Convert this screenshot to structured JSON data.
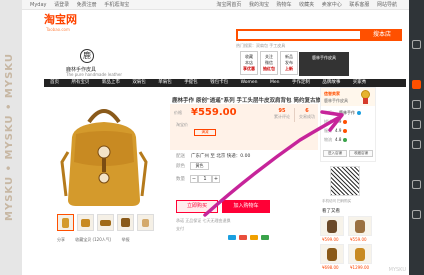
{
  "watermark": {
    "vertical": "MYSKU • MYSKU • MYSKU",
    "corner": "MYSKU"
  },
  "topbar": {
    "left": [
      "Myday",
      "请登录",
      "免费注册",
      "手机逛淘宝"
    ],
    "right": [
      "淘宝网首页",
      "我的淘宝",
      "购物车",
      "收藏夹",
      "卖家中心",
      "联系客服",
      "网站导航"
    ]
  },
  "header": {
    "logo": "淘宝网",
    "logo_sub": "Taobao.com",
    "search_placeholder": "",
    "search_button": "搜本店",
    "hot": "热门搜索：双肩包 手工皮具"
  },
  "shop": {
    "logo_char": "鹿",
    "name": "鹿林手作皮具",
    "subtitle": "The pure handmade leather",
    "banners": [
      {
        "top": "收藏",
        "mid": "本店",
        "tag": "享优惠"
      },
      {
        "top": "关注",
        "mid": "微信",
        "tag": "抽红包"
      },
      {
        "top": "新品",
        "mid": "发布",
        "tag": "上新"
      }
    ],
    "banner_button": "鹿林手作皮具"
  },
  "nav": {
    "items": [
      "首页",
      "所有宝贝",
      "新品上市",
      "双肩包",
      "单肩包",
      "手提包",
      "钱包卡包",
      "Women",
      "Men",
      "手作定制",
      "品牌故事",
      "买家秀"
    ]
  },
  "product": {
    "title": "鹿林手作 原创\"逍遥\"系列 手工头层牛皮双肩背包 简约复古旅行包",
    "price_label": "价格",
    "price": "¥559.00",
    "promo_label": "淘宝价",
    "promo_badge": "满减",
    "stats": {
      "c1_num": "95",
      "c1_label": "累计评论",
      "c2_num": "6",
      "c2_label": "交易成功"
    },
    "rows": [
      {
        "label": "配送",
        "value": "广东广州 至 北京 快递：0.00"
      },
      {
        "label": "颜色",
        "value": "黄色"
      },
      {
        "label": "数量",
        "value": "1  件 (库存20件)"
      }
    ],
    "option": "黄色",
    "qty": {
      "minus": "−",
      "value": "1",
      "plus": "+"
    },
    "buy_now": "立即购买",
    "add_cart": "加入购物车",
    "promise": "承诺  正品保证  七天无理由退换",
    "payment": "支付"
  },
  "gallery": {
    "thumbs": [
      "thumb-1",
      "thumb-2",
      "thumb-3",
      "thumb-4",
      "thumb-5"
    ],
    "actions": [
      "分享",
      "收藏宝贝 (120人气)",
      "举报"
    ]
  },
  "shopcard": {
    "title": "信誉卖家",
    "name": "鹿林手作皮具",
    "rows": [
      {
        "label": "掌柜：",
        "value": "鹿林手作"
      },
      {
        "label": "描述",
        "value": "4.9"
      },
      {
        "label": "服务",
        "value": "4.9"
      },
      {
        "label": "物流",
        "value": "4.8"
      }
    ],
    "enter": "进入店铺",
    "fav": "收藏店铺"
  },
  "qr": {
    "label": "手机访问 扫码购买"
  },
  "recommend": {
    "heading": "看了又看",
    "items": [
      {
        "price": "¥599.00"
      },
      {
        "price": "¥559.00"
      },
      {
        "price": "¥698.00"
      },
      {
        "price": "¥1299.00"
      }
    ]
  },
  "colors": {
    "accent": "#ff5000",
    "cart": "#ff0036",
    "price": "#ff4400",
    "arrow": "#c6249a"
  }
}
